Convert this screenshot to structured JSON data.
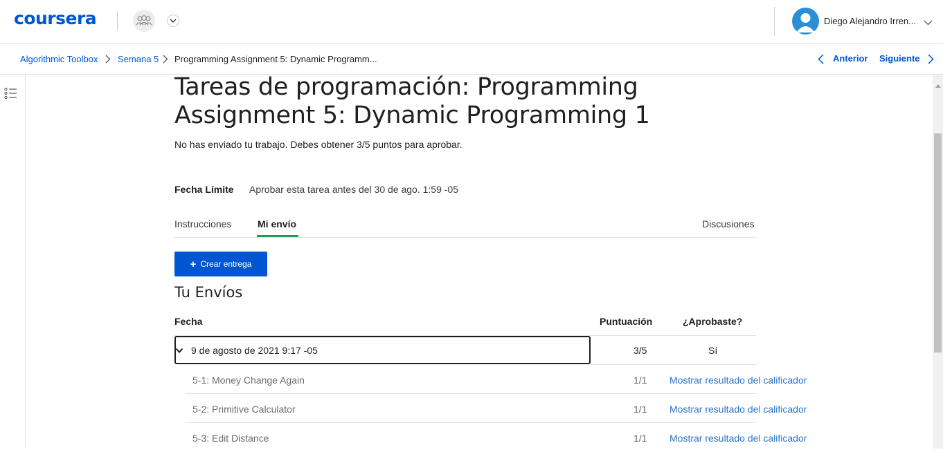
{
  "header": {
    "logo": "coursera",
    "user_name": "Diego Alejandro Irren..."
  },
  "breadcrumb": {
    "items": [
      "Algorithmic Toolbox",
      "Semana 5",
      "Programming Assignment 5: Dynamic Programm..."
    ],
    "prev_label": "Anterior",
    "next_label": "Siguiente"
  },
  "assignment": {
    "title": "Tareas de programación: Programming Assignment 5: Dynamic Programming 1",
    "status": "No has enviado tu trabajo. Debes obtener 3/5 puntos para aprobar.",
    "deadline_label": "Fecha Límite",
    "deadline_value": "Aprobar esta tarea antes del 30 de ago. 1:59 -05"
  },
  "tabs": [
    {
      "label": "Instrucciones",
      "active": false
    },
    {
      "label": "Mi envío",
      "active": true
    },
    {
      "label": "Discusiones",
      "active": false
    }
  ],
  "create_button": "Crear entrega",
  "submissions": {
    "title": "Tu Envíos",
    "columns": [
      "Fecha",
      "Puntuación",
      "¿Aprobaste?"
    ],
    "rows": [
      {
        "date": "9 de agosto de 2021 9:17 -05",
        "score": "3/5",
        "passed": "Sí",
        "parts": [
          {
            "name": "5-1: Money Change Again",
            "score": "1/1",
            "link": "Mostrar resultado del calificador"
          },
          {
            "name": "5-2: Primitive Calculator",
            "score": "1/1",
            "link": "Mostrar resultado del calificador"
          },
          {
            "name": "5-3: Edit Distance",
            "score": "1/1",
            "link": "Mostrar resultado del calificador"
          }
        ]
      }
    ]
  },
  "colors": {
    "brand": "#0056d2",
    "tab_active": "#1f9d55",
    "link": "#2a73cc"
  }
}
